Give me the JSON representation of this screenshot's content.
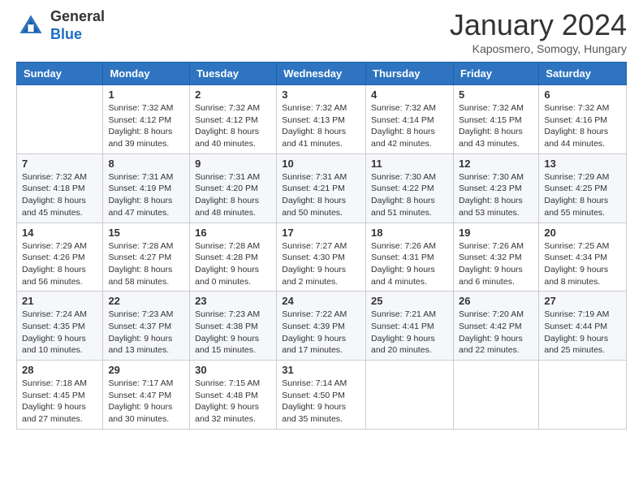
{
  "header": {
    "logo_general": "General",
    "logo_blue": "Blue",
    "month_title": "January 2024",
    "subtitle": "Kaposmero, Somogy, Hungary"
  },
  "days_of_week": [
    "Sunday",
    "Monday",
    "Tuesday",
    "Wednesday",
    "Thursday",
    "Friday",
    "Saturday"
  ],
  "weeks": [
    [
      {
        "day": "",
        "sunrise": "",
        "sunset": "",
        "daylight": ""
      },
      {
        "day": "1",
        "sunrise": "Sunrise: 7:32 AM",
        "sunset": "Sunset: 4:12 PM",
        "daylight": "Daylight: 8 hours and 39 minutes."
      },
      {
        "day": "2",
        "sunrise": "Sunrise: 7:32 AM",
        "sunset": "Sunset: 4:12 PM",
        "daylight": "Daylight: 8 hours and 40 minutes."
      },
      {
        "day": "3",
        "sunrise": "Sunrise: 7:32 AM",
        "sunset": "Sunset: 4:13 PM",
        "daylight": "Daylight: 8 hours and 41 minutes."
      },
      {
        "day": "4",
        "sunrise": "Sunrise: 7:32 AM",
        "sunset": "Sunset: 4:14 PM",
        "daylight": "Daylight: 8 hours and 42 minutes."
      },
      {
        "day": "5",
        "sunrise": "Sunrise: 7:32 AM",
        "sunset": "Sunset: 4:15 PM",
        "daylight": "Daylight: 8 hours and 43 minutes."
      },
      {
        "day": "6",
        "sunrise": "Sunrise: 7:32 AM",
        "sunset": "Sunset: 4:16 PM",
        "daylight": "Daylight: 8 hours and 44 minutes."
      }
    ],
    [
      {
        "day": "7",
        "sunrise": "Sunrise: 7:32 AM",
        "sunset": "Sunset: 4:18 PM",
        "daylight": "Daylight: 8 hours and 45 minutes."
      },
      {
        "day": "8",
        "sunrise": "Sunrise: 7:31 AM",
        "sunset": "Sunset: 4:19 PM",
        "daylight": "Daylight: 8 hours and 47 minutes."
      },
      {
        "day": "9",
        "sunrise": "Sunrise: 7:31 AM",
        "sunset": "Sunset: 4:20 PM",
        "daylight": "Daylight: 8 hours and 48 minutes."
      },
      {
        "day": "10",
        "sunrise": "Sunrise: 7:31 AM",
        "sunset": "Sunset: 4:21 PM",
        "daylight": "Daylight: 8 hours and 50 minutes."
      },
      {
        "day": "11",
        "sunrise": "Sunrise: 7:30 AM",
        "sunset": "Sunset: 4:22 PM",
        "daylight": "Daylight: 8 hours and 51 minutes."
      },
      {
        "day": "12",
        "sunrise": "Sunrise: 7:30 AM",
        "sunset": "Sunset: 4:23 PM",
        "daylight": "Daylight: 8 hours and 53 minutes."
      },
      {
        "day": "13",
        "sunrise": "Sunrise: 7:29 AM",
        "sunset": "Sunset: 4:25 PM",
        "daylight": "Daylight: 8 hours and 55 minutes."
      }
    ],
    [
      {
        "day": "14",
        "sunrise": "Sunrise: 7:29 AM",
        "sunset": "Sunset: 4:26 PM",
        "daylight": "Daylight: 8 hours and 56 minutes."
      },
      {
        "day": "15",
        "sunrise": "Sunrise: 7:28 AM",
        "sunset": "Sunset: 4:27 PM",
        "daylight": "Daylight: 8 hours and 58 minutes."
      },
      {
        "day": "16",
        "sunrise": "Sunrise: 7:28 AM",
        "sunset": "Sunset: 4:28 PM",
        "daylight": "Daylight: 9 hours and 0 minutes."
      },
      {
        "day": "17",
        "sunrise": "Sunrise: 7:27 AM",
        "sunset": "Sunset: 4:30 PM",
        "daylight": "Daylight: 9 hours and 2 minutes."
      },
      {
        "day": "18",
        "sunrise": "Sunrise: 7:26 AM",
        "sunset": "Sunset: 4:31 PM",
        "daylight": "Daylight: 9 hours and 4 minutes."
      },
      {
        "day": "19",
        "sunrise": "Sunrise: 7:26 AM",
        "sunset": "Sunset: 4:32 PM",
        "daylight": "Daylight: 9 hours and 6 minutes."
      },
      {
        "day": "20",
        "sunrise": "Sunrise: 7:25 AM",
        "sunset": "Sunset: 4:34 PM",
        "daylight": "Daylight: 9 hours and 8 minutes."
      }
    ],
    [
      {
        "day": "21",
        "sunrise": "Sunrise: 7:24 AM",
        "sunset": "Sunset: 4:35 PM",
        "daylight": "Daylight: 9 hours and 10 minutes."
      },
      {
        "day": "22",
        "sunrise": "Sunrise: 7:23 AM",
        "sunset": "Sunset: 4:37 PM",
        "daylight": "Daylight: 9 hours and 13 minutes."
      },
      {
        "day": "23",
        "sunrise": "Sunrise: 7:23 AM",
        "sunset": "Sunset: 4:38 PM",
        "daylight": "Daylight: 9 hours and 15 minutes."
      },
      {
        "day": "24",
        "sunrise": "Sunrise: 7:22 AM",
        "sunset": "Sunset: 4:39 PM",
        "daylight": "Daylight: 9 hours and 17 minutes."
      },
      {
        "day": "25",
        "sunrise": "Sunrise: 7:21 AM",
        "sunset": "Sunset: 4:41 PM",
        "daylight": "Daylight: 9 hours and 20 minutes."
      },
      {
        "day": "26",
        "sunrise": "Sunrise: 7:20 AM",
        "sunset": "Sunset: 4:42 PM",
        "daylight": "Daylight: 9 hours and 22 minutes."
      },
      {
        "day": "27",
        "sunrise": "Sunrise: 7:19 AM",
        "sunset": "Sunset: 4:44 PM",
        "daylight": "Daylight: 9 hours and 25 minutes."
      }
    ],
    [
      {
        "day": "28",
        "sunrise": "Sunrise: 7:18 AM",
        "sunset": "Sunset: 4:45 PM",
        "daylight": "Daylight: 9 hours and 27 minutes."
      },
      {
        "day": "29",
        "sunrise": "Sunrise: 7:17 AM",
        "sunset": "Sunset: 4:47 PM",
        "daylight": "Daylight: 9 hours and 30 minutes."
      },
      {
        "day": "30",
        "sunrise": "Sunrise: 7:15 AM",
        "sunset": "Sunset: 4:48 PM",
        "daylight": "Daylight: 9 hours and 32 minutes."
      },
      {
        "day": "31",
        "sunrise": "Sunrise: 7:14 AM",
        "sunset": "Sunset: 4:50 PM",
        "daylight": "Daylight: 9 hours and 35 minutes."
      },
      {
        "day": "",
        "sunrise": "",
        "sunset": "",
        "daylight": ""
      },
      {
        "day": "",
        "sunrise": "",
        "sunset": "",
        "daylight": ""
      },
      {
        "day": "",
        "sunrise": "",
        "sunset": "",
        "daylight": ""
      }
    ]
  ]
}
